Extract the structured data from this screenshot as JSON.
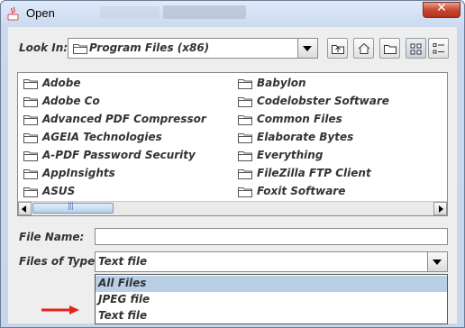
{
  "window": {
    "title": "Open"
  },
  "lookin": {
    "label": "Look In:",
    "value": "Program Files (x86)"
  },
  "toolbar": {
    "up": "up-one-level-icon",
    "home": "home-icon",
    "newfolder": "new-folder-icon",
    "list": "list-view-icon",
    "details": "details-view-icon"
  },
  "files": {
    "left": [
      "Adobe",
      "Adobe Co",
      "Advanced PDF Compressor",
      "AGEIA Technologies",
      "A-PDF Password Security",
      "AppInsights",
      "ASUS"
    ],
    "right": [
      "Babylon",
      "Codelobster Software",
      "Common Files",
      "Elaborate Bytes",
      "Everything",
      "FileZilla FTP Client",
      "Foxit Software"
    ]
  },
  "filename": {
    "label": "File Name:",
    "value": ""
  },
  "filetype": {
    "label": "Files of Type:",
    "value": "Text file",
    "options": [
      "All Files",
      "JPEG file",
      "Text file"
    ],
    "highlighted": "All Files"
  },
  "colors": {
    "annotation_arrow": "#e8231b",
    "selection": "#b8cfe5"
  }
}
